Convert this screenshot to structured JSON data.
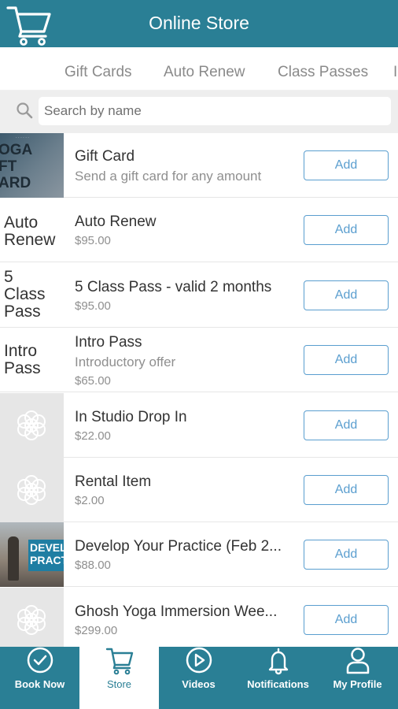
{
  "header": {
    "title": "Online Store",
    "logo_icon": "shopping-cart-icon",
    "bg_color": "#2a7f95"
  },
  "tabs": [
    "Gift Cards",
    "Auto Renew",
    "Class Passes",
    "I"
  ],
  "search": {
    "placeholder": "Search by name",
    "icon": "search-icon"
  },
  "products": [
    {
      "thumb_text": "",
      "thumb_art": "YOGA GIFT CARD",
      "name": "Gift Card",
      "subtitle": "Send a gift card for any amount",
      "price": "",
      "button": "Add"
    },
    {
      "thumb_text": "Auto Renew",
      "name": "Auto Renew",
      "subtitle": "",
      "price": "$95.00",
      "button": "Add"
    },
    {
      "thumb_text": "5 Class Pass",
      "name": "5 Class Pass - valid 2 months",
      "subtitle": "",
      "price": "$95.00",
      "button": "Add"
    },
    {
      "thumb_text": "Intro Pass",
      "name": "Intro Pass",
      "subtitle": "Introductory offer",
      "price": "$65.00",
      "button": "Add"
    },
    {
      "thumb_text": "",
      "name": "In Studio Drop In",
      "subtitle": "",
      "price": "$22.00",
      "button": "Add"
    },
    {
      "thumb_text": "",
      "name": "Rental Item",
      "subtitle": "",
      "price": "$2.00",
      "button": "Add"
    },
    {
      "thumb_text": "",
      "thumb_art": "DEVEL PRACT",
      "name": "Develop Your Practice (Feb 2...",
      "subtitle": "",
      "price": "$88.00",
      "button": "Add"
    },
    {
      "thumb_text": "",
      "name": "Ghosh Yoga Immersion Wee...",
      "subtitle": "",
      "price": "$299.00",
      "button": "Add"
    }
  ],
  "bottom_nav": [
    {
      "label": "Book Now",
      "icon": "check-circle-icon",
      "active": false
    },
    {
      "label": "Store",
      "icon": "shopping-cart-icon",
      "active": true
    },
    {
      "label": "Videos",
      "icon": "play-circle-icon",
      "active": false
    },
    {
      "label": "Notifications",
      "icon": "bell-icon",
      "active": false
    },
    {
      "label": "My Profile",
      "icon": "user-icon",
      "active": false
    }
  ],
  "colors": {
    "brand": "#2a7f95",
    "button_accent": "#5a9ecf",
    "muted_text": "#8f8f8f"
  }
}
